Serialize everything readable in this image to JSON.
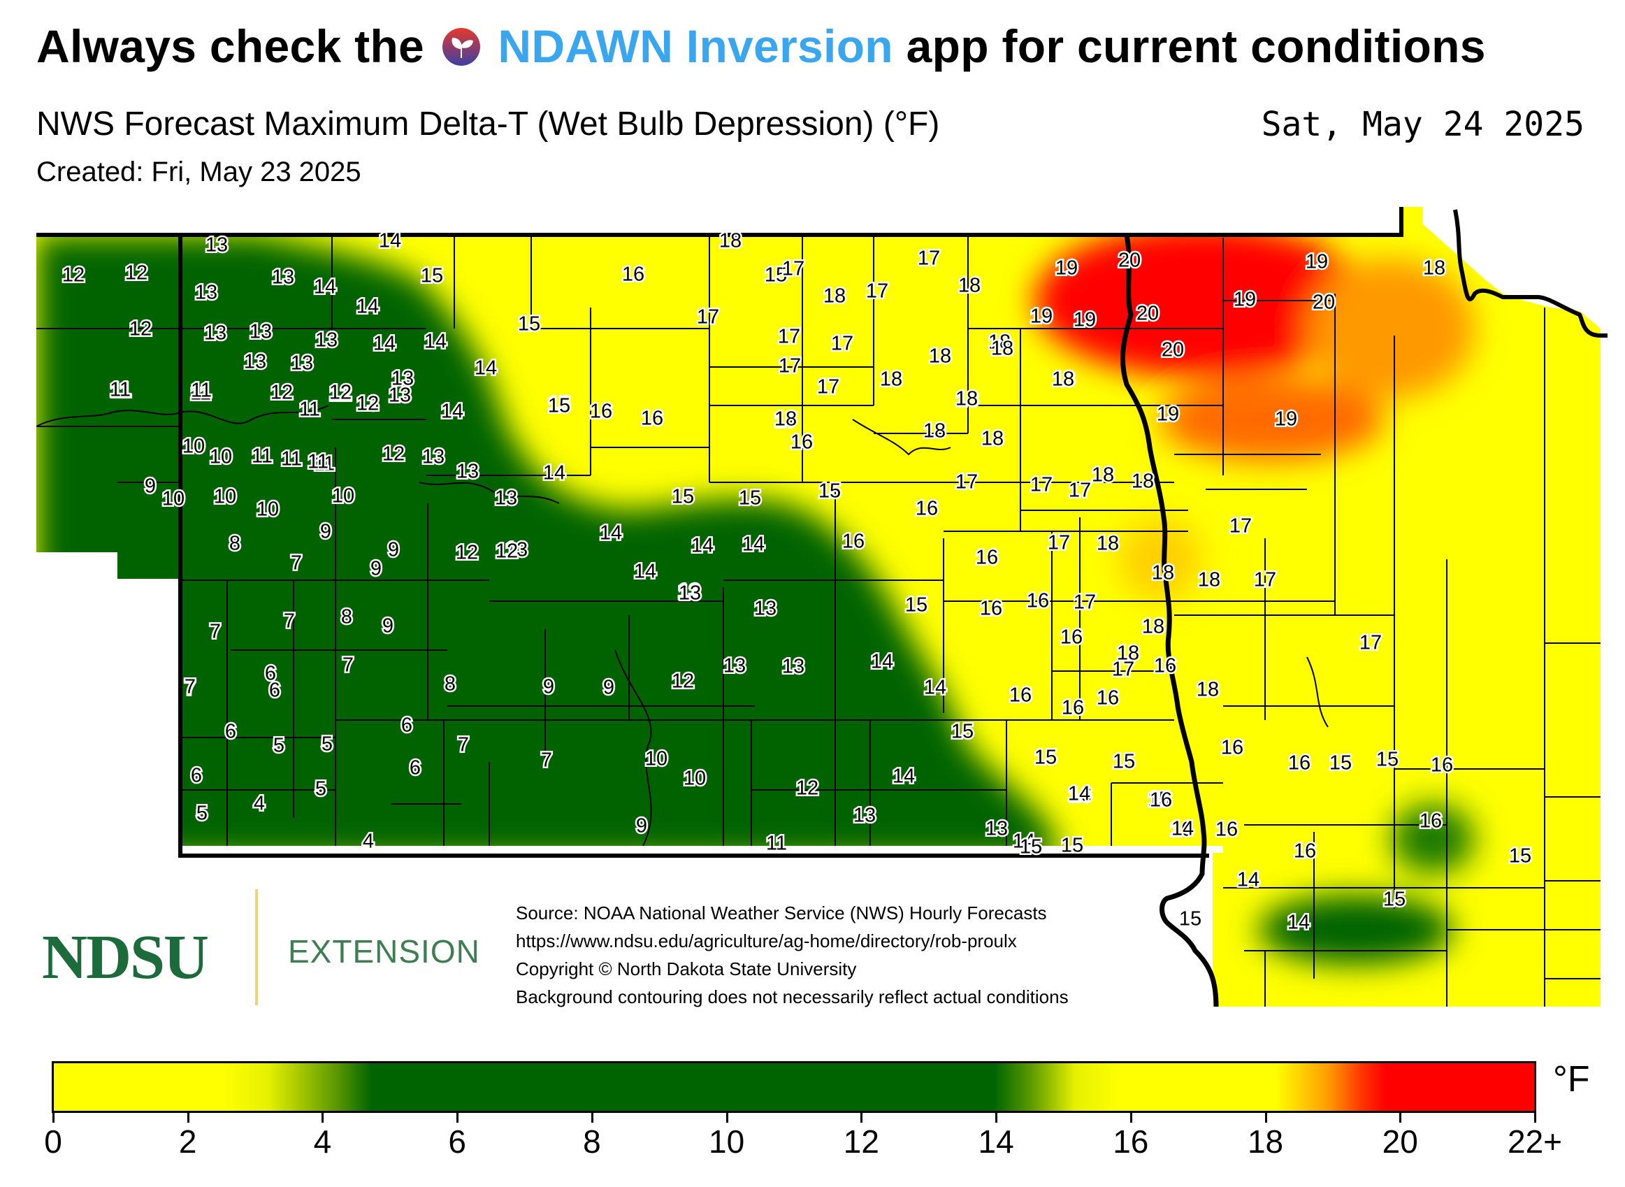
{
  "header": {
    "lead": "Always check the",
    "app_name": "NDAWN Inversion",
    "tail": "app for current conditions",
    "subtitle": "NWS Forecast Maximum Delta-T (Wet Bulb Depression) (°F)",
    "date": "Sat, May 24 2025",
    "created": "Created: Fri, May 23 2025"
  },
  "branding": {
    "logo": "NDSU",
    "extension": "EXTENSION",
    "icon": "ndawn-leaf-icon"
  },
  "source_lines": [
    "Source: NOAA National Weather Service (NWS) Hourly Forecasts",
    "https://www.ndsu.edu/agriculture/ag-home/directory/rob-proulx",
    "Copyright © North Dakota State University",
    "Background contouring does not necessarily reflect actual conditions"
  ],
  "colorbar": {
    "unit": "°F",
    "ticks": [
      "0",
      "2",
      "4",
      "6",
      "8",
      "10",
      "12",
      "14",
      "16",
      "18",
      "20",
      "22+"
    ],
    "colors": {
      "low": "#ffff00",
      "mid": "#006400",
      "high": "#ff0000"
    }
  },
  "values": [
    "12",
    "12",
    "13",
    "13",
    "14",
    "14",
    "15",
    "15",
    "16",
    "18",
    "15",
    "17",
    "18",
    "17",
    "17",
    "18",
    "19",
    "20",
    "19",
    "18",
    "12",
    "13",
    "13",
    "13",
    "13",
    "14",
    "14",
    "14",
    "14",
    "17",
    "17",
    "17",
    "17",
    "18",
    "18",
    "19",
    "19",
    "20",
    "19",
    "20",
    "20",
    "13",
    "13",
    "11",
    "11",
    "12",
    "11",
    "12",
    "13",
    "13",
    "14",
    "15",
    "16",
    "16",
    "17",
    "17",
    "18",
    "18",
    "18",
    "18",
    "19",
    "19",
    "11",
    "11",
    "13",
    "11",
    "12",
    "12",
    "13",
    "14",
    "15",
    "18",
    "18",
    "16",
    "18",
    "18",
    "18",
    "10",
    "10",
    "11",
    "11",
    "11",
    "11",
    "12",
    "13",
    "13",
    "14",
    "9",
    "10",
    "10",
    "10",
    "10",
    "13",
    "15",
    "15",
    "15",
    "16",
    "17",
    "17",
    "17",
    "18",
    "18",
    "17",
    "8",
    "9",
    "9",
    "7",
    "9",
    "12",
    "13",
    "14",
    "14",
    "14",
    "13",
    "14",
    "16",
    "16",
    "17",
    "18",
    "18",
    "18",
    "17",
    "7",
    "7",
    "8",
    "9",
    "12",
    "13",
    "13",
    "15",
    "16",
    "16",
    "17",
    "18",
    "18",
    "16",
    "17",
    "7",
    "7",
    "6",
    "6",
    "7",
    "8",
    "9",
    "9",
    "12",
    "13",
    "13",
    "14",
    "14",
    "16",
    "16",
    "17",
    "16",
    "18",
    "16",
    "6",
    "5",
    "5",
    "6",
    "6",
    "7",
    "7",
    "10",
    "10",
    "12",
    "14",
    "15",
    "15",
    "16",
    "15",
    "16",
    "16",
    "15",
    "15",
    "16",
    "6",
    "5",
    "4",
    "5",
    "4",
    "9",
    "11",
    "13",
    "13",
    "14",
    "14",
    "15",
    "16",
    "16",
    "16",
    "16",
    "14",
    "15",
    "15",
    "16",
    "14",
    "15",
    "14",
    "15",
    "15"
  ]
}
